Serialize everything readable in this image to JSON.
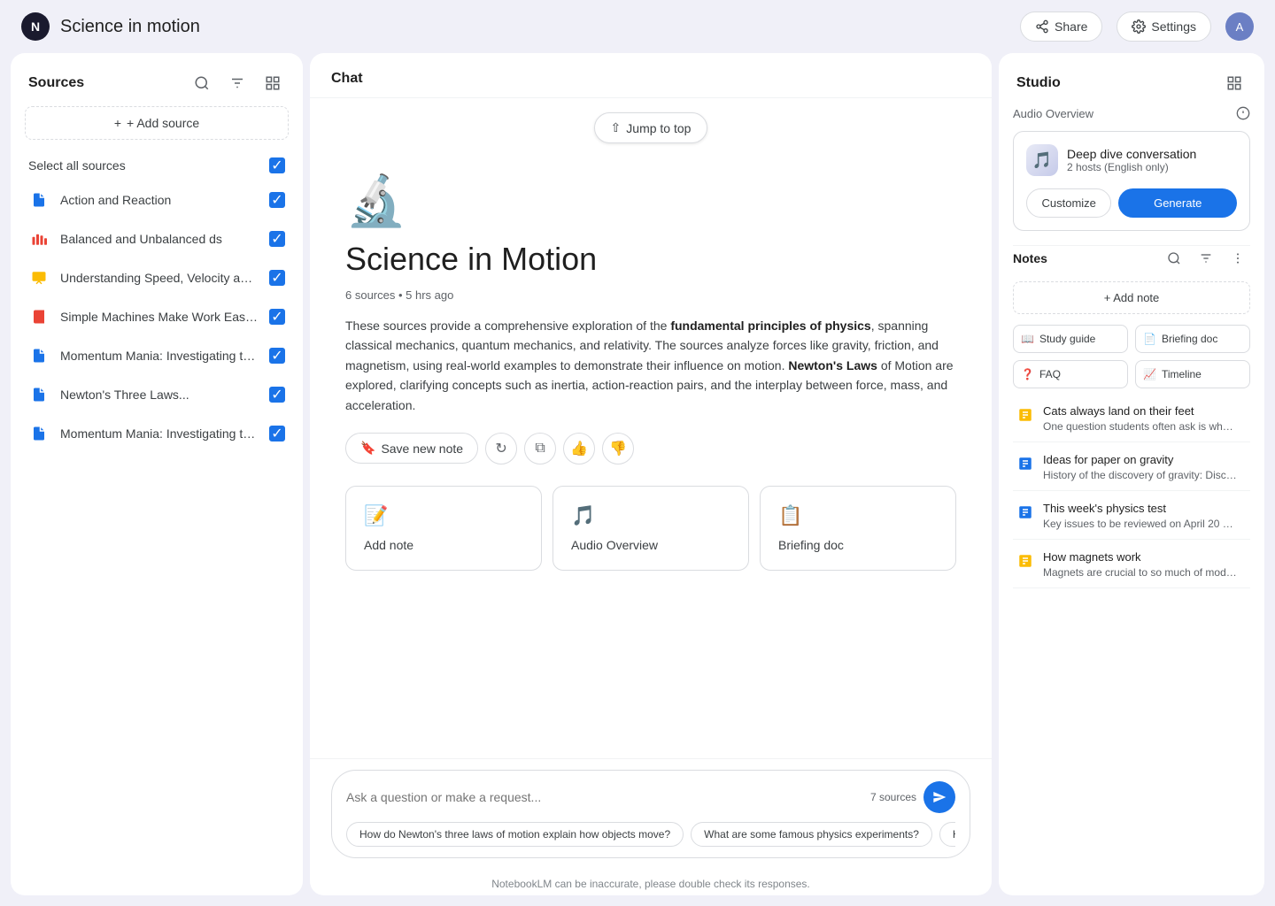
{
  "app": {
    "title": "Science in motion",
    "logo_text": "N"
  },
  "topbar": {
    "share_label": "Share",
    "settings_label": "Settings",
    "avatar_text": "A"
  },
  "sidebar": {
    "title": "Sources",
    "add_source_label": "+ Add source",
    "select_all_label": "Select all sources",
    "sources": [
      {
        "id": 1,
        "name": "Action and Reaction",
        "icon": "📄",
        "icon_color": "#1a73e8",
        "checked": true
      },
      {
        "id": 2,
        "name": "Balanced and Unbalanced ds",
        "icon": "🎵",
        "icon_color": "#ea4335",
        "checked": true
      },
      {
        "id": 3,
        "name": "Understanding Speed, Velocity and...",
        "icon": "📋",
        "icon_color": "#fbbc04",
        "checked": true
      },
      {
        "id": 4,
        "name": "Simple Machines Make Work Easier...",
        "icon": "📕",
        "icon_color": "#ea4335",
        "checked": true
      },
      {
        "id": 5,
        "name": "Momentum Mania: Investigating th...",
        "icon": "📄",
        "icon_color": "#1a73e8",
        "checked": true
      },
      {
        "id": 6,
        "name": "Newton's Three Laws...",
        "icon": "📄",
        "icon_color": "#1a73e8",
        "checked": true
      },
      {
        "id": 7,
        "name": "Momentum Mania: Investigating th...",
        "icon": "📋",
        "icon_color": "#1a73e8",
        "checked": true
      }
    ]
  },
  "chat": {
    "title": "Chat",
    "jump_to_top": "Jump to top",
    "notebook_emoji": "🔬",
    "message_title": "Science in Motion",
    "message_meta": "6 sources • 5 hrs ago",
    "message_body_plain": "These sources provide a comprehensive exploration of the ",
    "message_body_bold": "fundamental principles of physics",
    "message_body_rest": ", spanning classical mechanics, quantum mechanics, and relativity. The sources analyze forces like gravity, friction, and magnetism, using real-world examples to demonstrate their influence on motion. ",
    "message_body_bold2": "Newton's Laws",
    "message_body_rest2": " of Motion are explored, clarifying concepts such as inertia, action-reaction pairs, and the interplay between force, mass, and acceleration.",
    "save_note_label": "Save new note",
    "suggestions": [
      {
        "icon": "📝",
        "label": "Add note"
      },
      {
        "icon": "🎵",
        "label": "Audio Overview"
      },
      {
        "icon": "📋",
        "label": "Briefing doc"
      }
    ],
    "input_placeholder": "Ask a question or make a request...",
    "sources_count": "7 sources",
    "chips": [
      "How do Newton's three laws of motion explain how objects move?",
      "What are some famous physics experiments?",
      "How do the laws of gra... at very high speeds or..."
    ],
    "footer": "NotebookLM can be inaccurate, please double check its responses."
  },
  "studio": {
    "title": "Studio",
    "audio_overview_label": "Audio Overview",
    "deep_dive_title": "Deep dive conversation",
    "deep_dive_subtitle": "2 hosts (English only)",
    "customize_label": "Customize",
    "generate_label": "Generate",
    "notes_title": "Notes",
    "add_note_label": "+ Add note",
    "note_type_btns": [
      {
        "icon": "📖",
        "label": "Study guide"
      },
      {
        "icon": "📄",
        "label": "Briefing doc"
      },
      {
        "icon": "❓",
        "label": "FAQ"
      },
      {
        "icon": "📈",
        "label": "Timeline"
      }
    ],
    "notes": [
      {
        "id": 1,
        "color": "#fbbc04",
        "title": "Cats always land on their feet",
        "preview": "One question students often ask is why cats always land on their feet. It's a fasci..."
      },
      {
        "id": 2,
        "color": "#1a73e8",
        "title": "Ideas for paper on gravity",
        "preview": "History of the discovery of gravity: Discuss the thinkers that preceded Newt..."
      },
      {
        "id": 3,
        "color": "#1a73e8",
        "title": "This week's physics test",
        "preview": "Key issues to be reviewed on April 20 exam. Motion and Momentum. Conserva..."
      },
      {
        "id": 4,
        "color": "#fbbc04",
        "title": "How magnets work",
        "preview": "Magnets are crucial to so much of modern life. But how do they really work..."
      }
    ]
  }
}
